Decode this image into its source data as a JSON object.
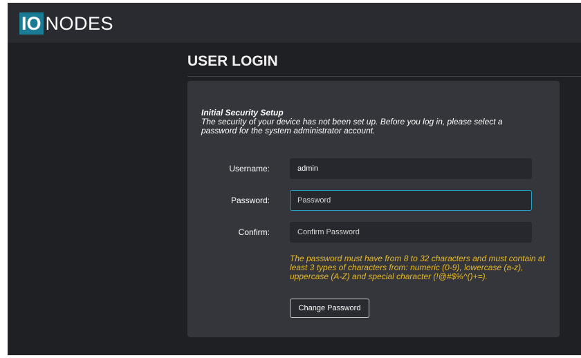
{
  "header": {
    "logo_mark": "IO",
    "logo_text": "NODES"
  },
  "page": {
    "title": "USER LOGIN"
  },
  "setup": {
    "title": "Initial Security Setup",
    "description": "The security of your device has not been set up. Before you log in, please select a password for the system administrator account."
  },
  "form": {
    "username_label": "Username:",
    "username_value": "admin",
    "password_label": "Password:",
    "password_placeholder": "Password",
    "confirm_label": "Confirm:",
    "confirm_placeholder": "Confirm Password",
    "hint": "The password must have from 8 to 32 characters and must contain at least 3 types of characters from: numeric (0-9), lowercase (a-z), uppercase (A-Z) and special character (!@#$%^()+=).",
    "submit_label": "Change Password"
  },
  "colors": {
    "brand_accent": "#1b7a94",
    "focus_border": "#1ea3c7",
    "hint_text": "#e8b923",
    "page_background": "#1f2023",
    "header_background": "#2a2b30",
    "panel_background": "#35363c",
    "input_background": "#27282d"
  }
}
